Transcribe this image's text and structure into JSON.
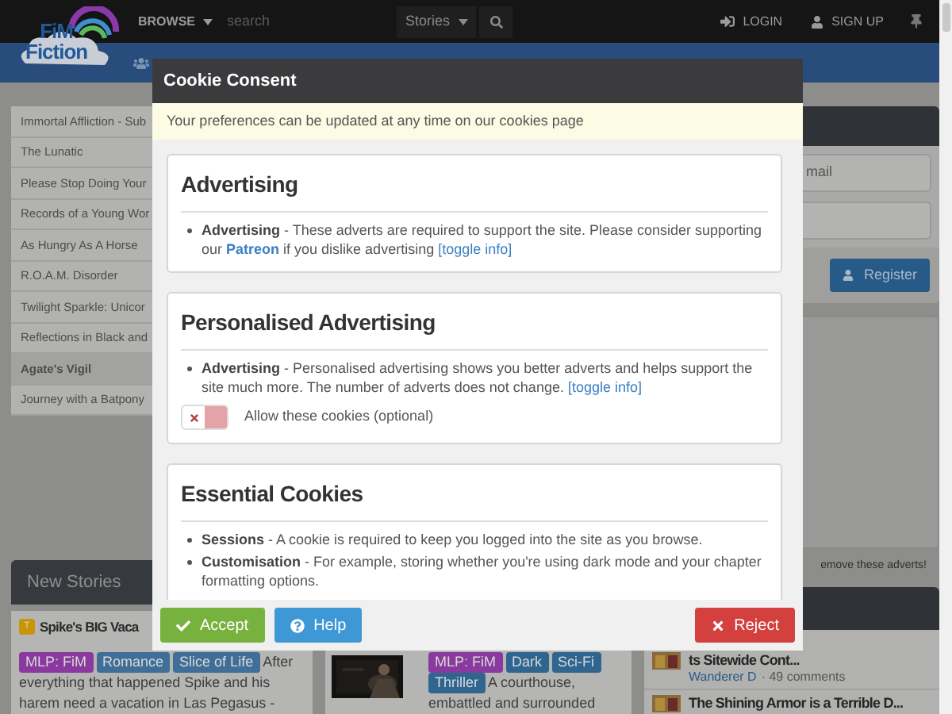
{
  "logo": [
    "FiM",
    "Fiction"
  ],
  "navbar": {
    "browse": "BROWSE",
    "search": {
      "placeholder": "search"
    },
    "search_scope": "Stories",
    "login": "LOGIN",
    "signup": "SIGN UP"
  },
  "featured_list": [
    {
      "title": "Immortal Affliction - Sub",
      "selected": false
    },
    {
      "title": "The Lunatic",
      "selected": false
    },
    {
      "title": "Please Stop Doing Your",
      "selected": false
    },
    {
      "title": "Records of a Young Wor",
      "selected": false
    },
    {
      "title": "As Hungry As A Horse",
      "selected": false
    },
    {
      "title": "R.O.A.M. Disorder",
      "selected": false
    },
    {
      "title": "Twilight Sparkle: Unicor",
      "selected": false
    },
    {
      "title": "Reflections in Black and",
      "selected": false
    },
    {
      "title": "Agate's Vigil",
      "selected": true
    },
    {
      "title": "Journey with a Batpony",
      "selected": false
    }
  ],
  "new_stories": {
    "title": "New Stories",
    "stories": [
      {
        "rating": "T",
        "title": "Spike's BIG Vaca",
        "tags": [
          {
            "label": "MLP: FiM",
            "color": "#8a3a9e"
          },
          {
            "label": "Romance",
            "color": "#3f6f99"
          },
          {
            "label": "Slice of Life",
            "color": "#3f6f99"
          }
        ],
        "description": "After everything that happened Spike and his harem need a vacation in Las Pegasus  -"
      },
      {
        "kind": "picture",
        "tags": [
          {
            "label": "MLP: FiM",
            "color": "#8a3a9e"
          },
          {
            "label": "Dark",
            "color": "#2f6690"
          },
          {
            "label": "Sci-Fi",
            "color": "#2f6690"
          },
          {
            "label": "Thriller",
            "color": "#2f6690"
          }
        ],
        "description": "A courthouse, embattled and surrounded"
      }
    ]
  },
  "login_panel": {
    "email": {
      "placeholder": "mail"
    },
    "register": "Register"
  },
  "ad_notice": "emove these adverts!",
  "blog_posts": [
    {
      "title": "ts Sitewide Cont...",
      "author": "Wanderer D",
      "comments": "· 49 comments"
    },
    {
      "title": "The Shining Armor is a Terrible D..."
    }
  ],
  "cookie_modal": {
    "title": "Cookie Consent",
    "notice": "Your preferences can be updated at any time on our cookies page",
    "sections": [
      {
        "heading": "Advertising",
        "items": [
          {
            "term": "Advertising",
            "parts": [
              {
                "text": " - These adverts are required to support the site. Please consider supporting our "
              },
              {
                "link": "Patreon",
                "bold": true
              },
              {
                "text": " if you dislike advertising "
              },
              {
                "link": "[toggle info]",
                "bold": false
              }
            ]
          }
        ]
      },
      {
        "heading": "Personalised Advertising",
        "items": [
          {
            "term": "Advertising",
            "parts": [
              {
                "text": " - Personalised advertising shows you better adverts and helps support the site much more. The number of adverts does not change. "
              },
              {
                "link": "[toggle info]",
                "bold": false
              }
            ]
          }
        ],
        "toggle": {
          "label": "Allow these cookies (optional)",
          "on": false
        }
      },
      {
        "heading": "Essential Cookies",
        "items": [
          {
            "term": "Sessions",
            "parts": [
              {
                "text": " - A cookie is required to keep you logged into the site as you browse."
              }
            ]
          },
          {
            "term": "Customisation",
            "parts": [
              {
                "text": " - For example, storing whether you're using dark mode and your chapter formatting options."
              }
            ]
          }
        ]
      }
    ],
    "buttons": [
      {
        "label": "Accept",
        "kind": "accept"
      },
      {
        "label": "Help",
        "kind": "help"
      },
      {
        "label": "Reject",
        "kind": "reject"
      }
    ]
  }
}
